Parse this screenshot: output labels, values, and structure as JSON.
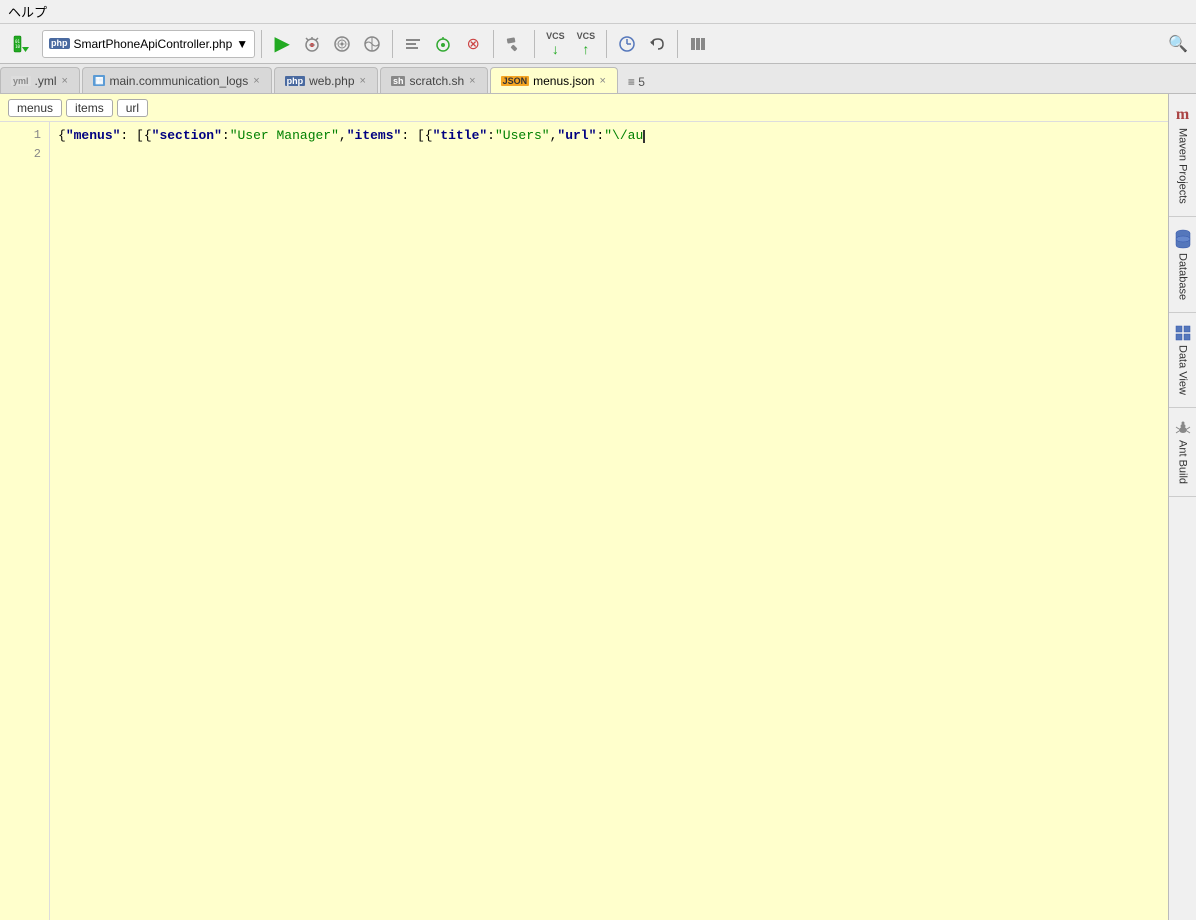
{
  "menubar": {
    "items": [
      "ヘルプ"
    ]
  },
  "toolbar": {
    "file_dropdown": {
      "icon": "PHP",
      "label": "SmartPhoneApiController.php",
      "dropdown_arrow": "▼"
    },
    "buttons": [
      {
        "name": "run-button",
        "icon": "▶",
        "color": "#22aa22"
      },
      {
        "name": "debug-button",
        "icon": "🐛"
      },
      {
        "name": "coverage-button",
        "icon": "⬡"
      },
      {
        "name": "profile-button",
        "icon": "◉"
      },
      {
        "name": "step-over-button",
        "icon": "⇒"
      },
      {
        "name": "stop-button",
        "icon": "⊗"
      },
      {
        "name": "build-button",
        "icon": "🔨"
      },
      {
        "name": "vcs-down-button",
        "vcs": true,
        "label": "VCS",
        "sub": "↓"
      },
      {
        "name": "vcs-up-button",
        "vcs": true,
        "label": "VCS",
        "sub": "↑"
      },
      {
        "name": "history-button",
        "icon": "🕐"
      },
      {
        "name": "undo-button",
        "icon": "↩"
      },
      {
        "name": "columns-button",
        "icon": "⋮"
      },
      {
        "name": "search-button",
        "icon": "🔍"
      }
    ]
  },
  "tabs": [
    {
      "id": "yml",
      "icon": "YML",
      "icon_type": "yml",
      "label": ".yml",
      "closable": true,
      "active": false
    },
    {
      "id": "main_communication_logs",
      "icon": "TABLE",
      "icon_type": "table",
      "label": "main.communication_logs",
      "closable": true,
      "active": false
    },
    {
      "id": "web_php",
      "icon": "PHP",
      "icon_type": "php",
      "label": "web.php",
      "closable": true,
      "active": false
    },
    {
      "id": "scratch_sh",
      "icon": "SH",
      "icon_type": "sh",
      "label": "scratch.sh",
      "closable": true,
      "active": false
    },
    {
      "id": "menus_json",
      "icon": "JSON",
      "icon_type": "json",
      "label": "menus.json",
      "closable": true,
      "active": true
    }
  ],
  "tabs_extra": "≡ 5",
  "breadcrumbs": [
    {
      "label": "menus"
    },
    {
      "label": "items"
    },
    {
      "label": "url"
    }
  ],
  "editor": {
    "lines": [
      {
        "number": 1,
        "content": "{\"menus\": [{\"section\":\"User Manager\",\"items\": [{\"title\":\"Users\",\"url\":\"\\/au"
      },
      {
        "number": 2,
        "content": ""
      }
    ],
    "cursor_line": 1,
    "cursor_after": "{\"menus\": [{\"section\":\"User Manager\",\"items\": [{\"title\":\"Users\",\"url\":\"\\/au"
  },
  "side_panel": [
    {
      "name": "maven-projects",
      "icon": "m",
      "label": "Maven Projects"
    },
    {
      "name": "database",
      "icon": "🗄",
      "label": "Database"
    },
    {
      "name": "data-view",
      "icon": "⊞",
      "label": "Data View"
    },
    {
      "name": "ant-build",
      "icon": "🐜",
      "label": "Ant Build"
    }
  ]
}
